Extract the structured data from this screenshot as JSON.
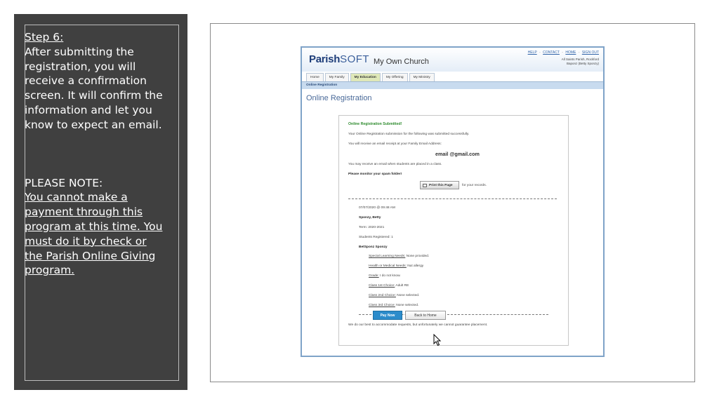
{
  "slide": {
    "step_title": "Step 6:",
    "step_body": "After submitting the registration, you will receive a confirmation screen. It will confirm the information and let you know to expect an email.",
    "note_title": "PLEASE NOTE:",
    "note_body": "You cannot make a payment through this program at this time. You must do it by check or the Parish Online Giving program."
  },
  "app": {
    "logo_parish": "Parish",
    "logo_soft": "SOFT",
    "church_name": "My Own Church",
    "top_links": [
      "HELP",
      "CONTACT",
      "HOME",
      "SIGN OUT"
    ],
    "parish_info_line1": "All Saints Parish, Rockford",
    "parish_info_line2": "Baponz (Betty Sponzy)",
    "tabs": [
      "Home",
      "My Family",
      "My Education",
      "My Offering",
      "My Ministry"
    ],
    "active_tab": "My Education",
    "subnav": "Online Registration",
    "page_heading": "Online Registration"
  },
  "confirmation": {
    "title": "Online Registration Submitted!",
    "line1": "Your Online Registration submission for the following was submitted successfully.",
    "line2": "You will receive an email receipt at your Family Email Address:",
    "email": "email @gmail.com",
    "line3": "You may receive an email when students are placed in a class.",
    "line4": "Please monitor your spam folder!",
    "print_label": "Print this Page",
    "print_suffix": "for your records.",
    "timestamp": "07/07/2020 @ 09:48 AM",
    "name": "Sponzy, Betty",
    "term": "Term: 2020-2021",
    "students": "Students Registered: 1",
    "student_name": "BetSponz Sponzy",
    "fields": [
      {
        "label": "Special Learning Needs:",
        "value": "None provided."
      },
      {
        "label": "Health or Medical Needs:",
        "value": "Nut allergy"
      },
      {
        "label": "Grade:",
        "value": "I do not know."
      },
      {
        "label": "Class 1st Choice:",
        "value": "Adult RE"
      },
      {
        "label": "Class 2nd Choice:",
        "value": "None selected."
      },
      {
        "label": "Class 3rd Choice:",
        "value": "None selected."
      }
    ],
    "footer_note": "We do our best to accommodate requests, but unfortunately we cannot guarantee placement.",
    "pay_now": "Pay Now",
    "back_home": "Back to Home"
  },
  "colors": {
    "panel": "#404040",
    "accent": "#2c8ccb",
    "success": "#2e8b2e",
    "header_blue": "#c8dbef"
  }
}
